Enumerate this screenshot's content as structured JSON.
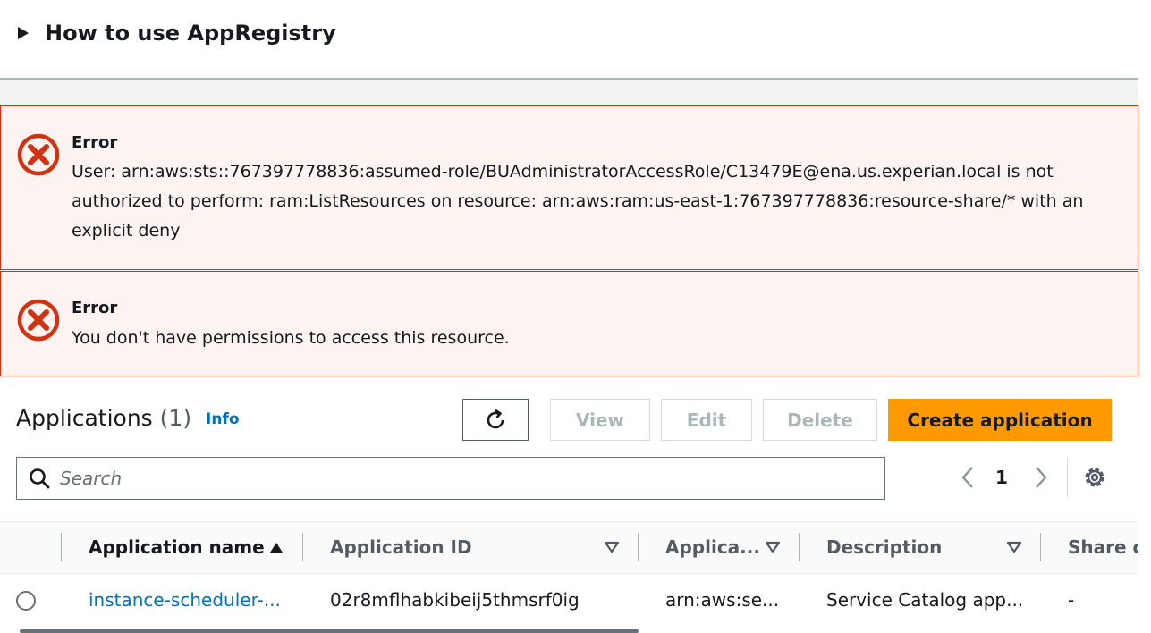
{
  "howto": {
    "title": "How to use AppRegistry"
  },
  "alerts": [
    {
      "title": "Error",
      "lines": [
        "User: arn:aws:sts::767397778836:assumed-role/BUAdministratorAccessRole/C13479E@ena.us.experian.local is not",
        "authorized to perform: ram:ListResources on resource: arn:aws:ram:us-east-1:767397778836:resource-share/* with an",
        "explicit deny"
      ]
    },
    {
      "title": "Error",
      "lines": [
        "You don't have permissions to access this resource."
      ]
    }
  ],
  "applications": {
    "heading": "Applications",
    "count": "(1)",
    "info": "Info",
    "buttons": {
      "view": "View",
      "edit": "Edit",
      "delete": "Delete",
      "create": "Create application"
    },
    "search": {
      "placeholder": "Search"
    },
    "pagination": {
      "current_page": "1"
    },
    "columns": [
      "Application name",
      "Application ID",
      "Applica...",
      "Description",
      "Share co"
    ],
    "rows": [
      [
        "instance-scheduler-...",
        "02r8mflhabkibeij5thmsrf0ig",
        "arn:aws:se...",
        "Service Catalog app...",
        "-"
      ]
    ]
  },
  "colors": {
    "error": "#d13212",
    "primary": "#ff9900",
    "link": "#0073bb"
  },
  "icons": [
    "caret-right-icon",
    "error-icon",
    "refresh-icon",
    "search-icon",
    "chevron-left-icon",
    "chevron-right-icon",
    "gear-icon",
    "sort-ascending-icon",
    "sort-descending-icon"
  ]
}
